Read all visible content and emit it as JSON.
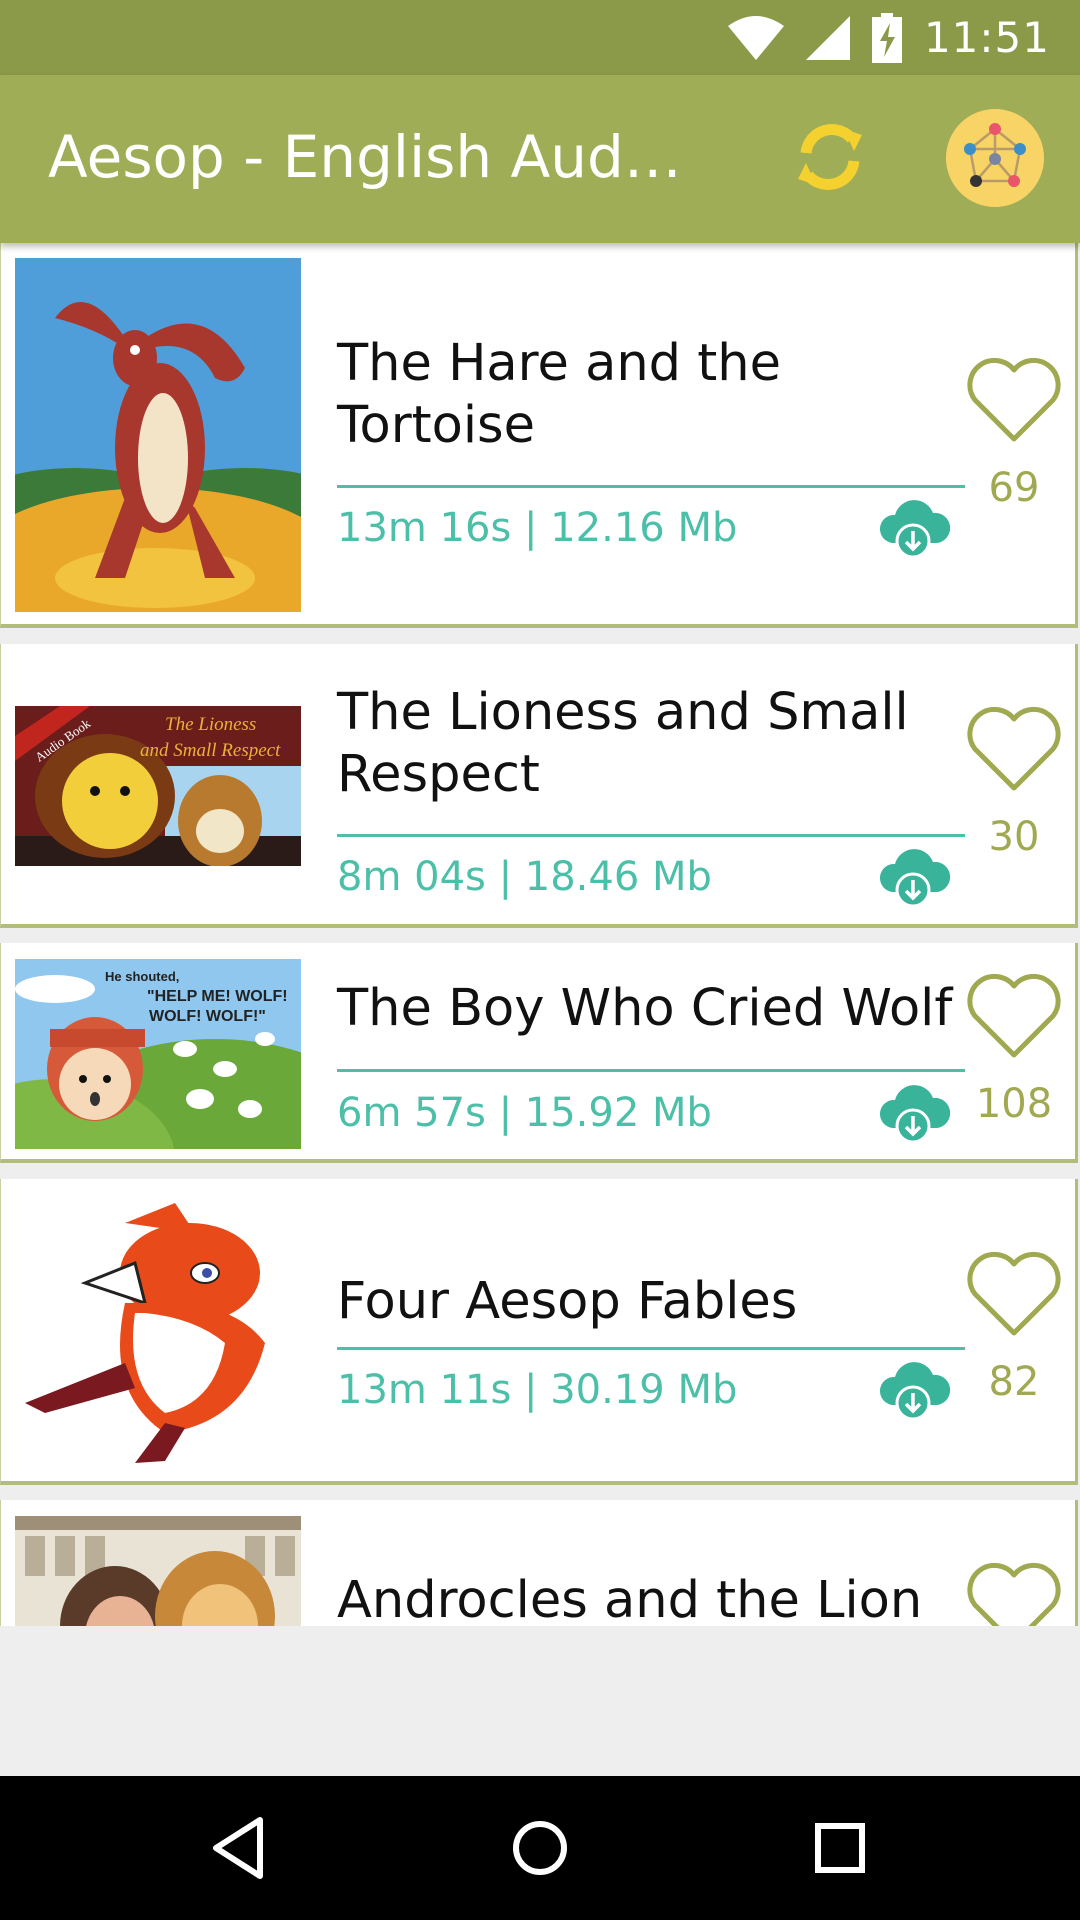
{
  "status_bar": {
    "time": "11:51"
  },
  "app_bar": {
    "title": "Aesop - English Audio…",
    "refresh_icon": "refresh-icon",
    "menu_icon": "network-avatar-icon"
  },
  "colors": {
    "header": "#9fad56",
    "status_bar": "#8a9a48",
    "accent": "#4bbfa8",
    "heart": "#a0a850"
  },
  "stories": [
    {
      "title": "The Hare and the Tortoise",
      "meta": "13m 16s | 12.16 Mb",
      "likes": "69"
    },
    {
      "title": "The Lioness and Small Respect",
      "meta": "8m 04s | 18.46 Mb",
      "likes": "30"
    },
    {
      "title": "The Boy Who Cried Wolf",
      "meta": "6m 57s | 15.92 Mb",
      "likes": "108"
    },
    {
      "title": "Four Aesop Fables",
      "meta": "13m 11s | 30.19 Mb",
      "likes": "82"
    },
    {
      "title": "Androcles and the Lion",
      "meta": "",
      "likes": ""
    }
  ],
  "thumbnail_text": {
    "lioness_badge": "Audio Book",
    "lioness_title_1": "The Lioness",
    "lioness_title_2": "and Small Respect",
    "wolf_caption_1": "He shouted,",
    "wolf_caption_2": "\"HELP ME! WOLF!",
    "wolf_caption_3": "WOLF! WOLF!\""
  }
}
